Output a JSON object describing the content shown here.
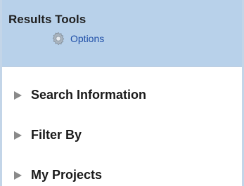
{
  "panel": {
    "title": "Results Tools",
    "options": {
      "label": "Options",
      "icon": "gear-icon"
    }
  },
  "sections": [
    {
      "label": "Search Information",
      "icon": "expand-arrow-icon"
    },
    {
      "label": "Filter By",
      "icon": "expand-arrow-icon"
    },
    {
      "label": "My Projects",
      "icon": "expand-arrow-icon"
    }
  ],
  "colors": {
    "header_bg": "#b8d1ea",
    "border": "#c3d5e8",
    "link": "#1f4fa8",
    "arrow": "#8a8a8a"
  }
}
